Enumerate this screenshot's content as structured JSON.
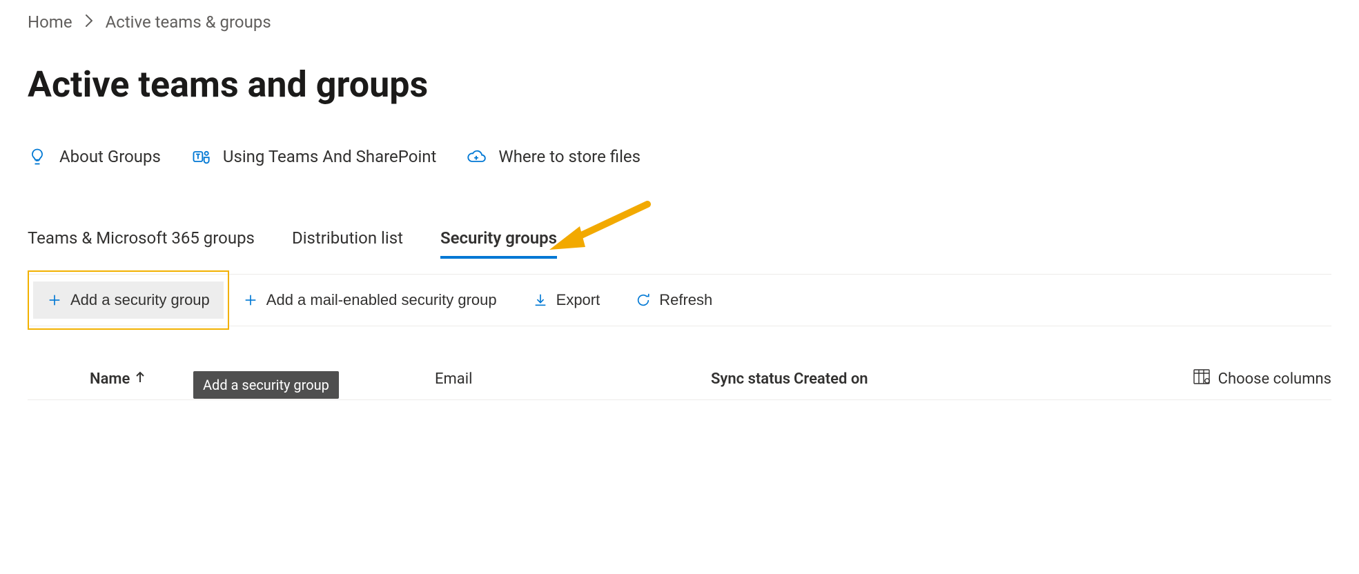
{
  "breadcrumb": {
    "home": "Home",
    "current": "Active teams & groups"
  },
  "page_title": "Active teams and groups",
  "infolinks": {
    "about": "About Groups",
    "teams_sp": "Using Teams And SharePoint",
    "store_files": "Where to store files"
  },
  "tabs": {
    "teams365": "Teams & Microsoft 365 groups",
    "distribution": "Distribution list",
    "security": "Security groups"
  },
  "commands": {
    "add_security": "Add a security group",
    "add_mail_security": "Add a mail-enabled security group",
    "export": "Export",
    "refresh": "Refresh"
  },
  "tooltip": {
    "add_security": "Add a security group"
  },
  "columns": {
    "name": "Name",
    "email": "Email",
    "sync": "Sync status",
    "created": "Created on",
    "choose": "Choose columns"
  }
}
